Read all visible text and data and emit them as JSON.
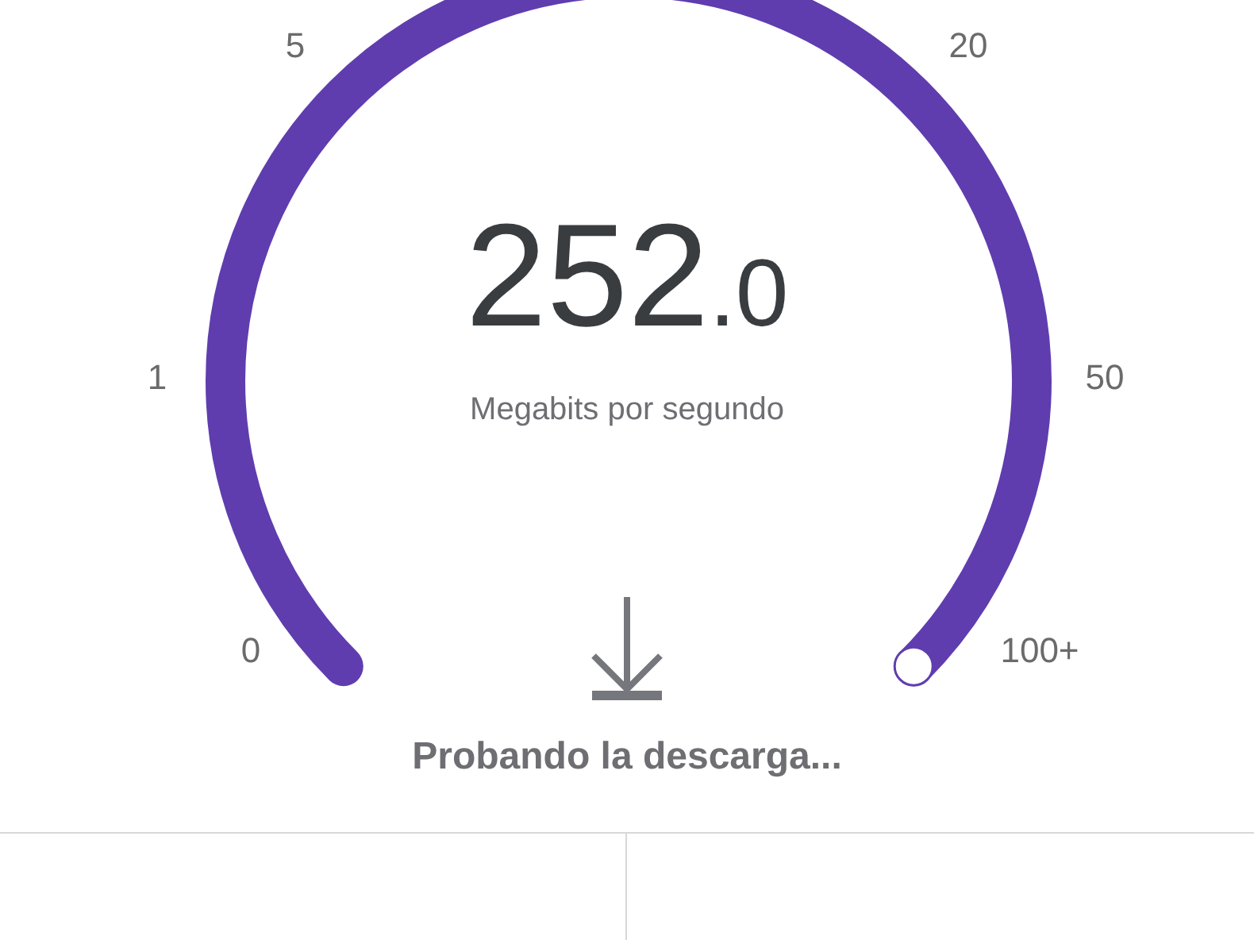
{
  "gauge": {
    "ticks": [
      "0",
      "1",
      "5",
      "20",
      "50",
      "100+"
    ],
    "value": "252",
    "decimal": ".0",
    "unit": "Megabits por segundo"
  },
  "status": "Probando la descarga..."
}
